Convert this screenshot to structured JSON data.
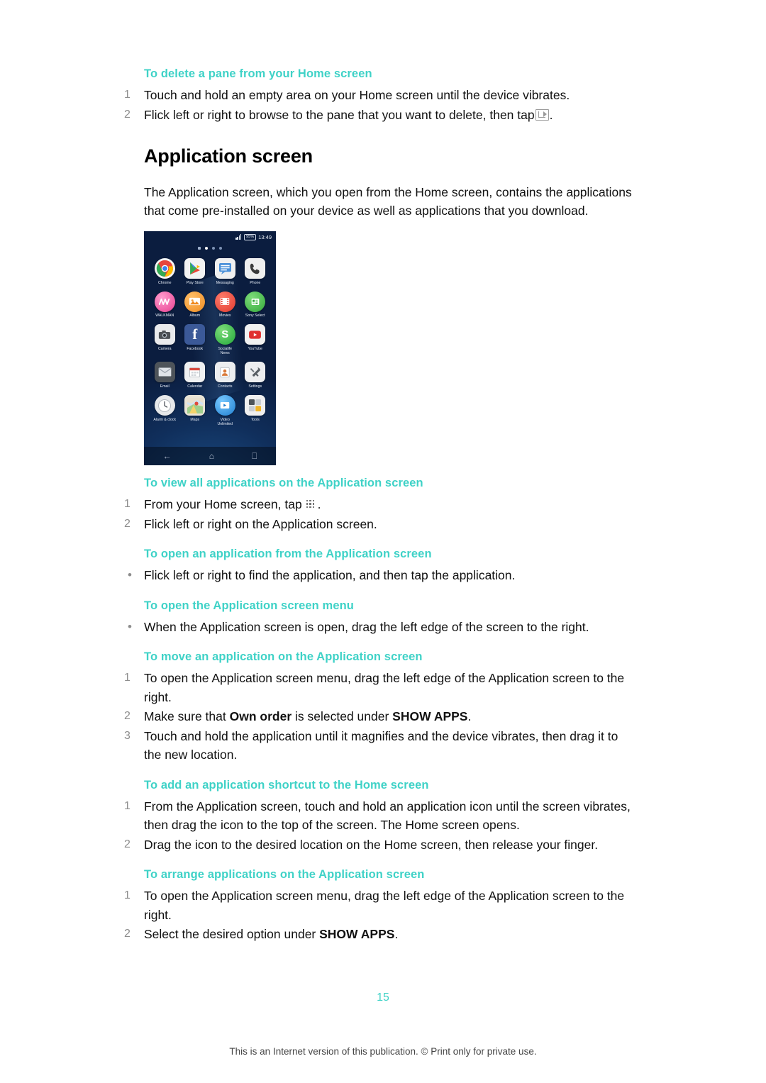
{
  "document": {
    "page_number": "15",
    "footer": "This is an Internet version of this publication. © Print only for private use."
  },
  "colors": {
    "heading_teal": "#3fd2c7",
    "body_text": "#111111",
    "step_number": "#8d8d8d"
  },
  "sections": [
    {
      "id": "delete-pane",
      "heading": "To delete a pane from your Home screen",
      "steps": [
        "Touch and hold an empty area on your Home screen until the device vibrates.",
        "Flick left or right to browse to the pane that you want to delete, then tap"
      ],
      "step2_suffix": "."
    }
  ],
  "application_screen": {
    "title": "Application screen",
    "intro": "The Application screen, which you open from the Home screen, contains the applications that come pre-installed on your device as well as applications that you download."
  },
  "phone": {
    "status": {
      "battery": "95%",
      "time": "13:49"
    },
    "apps": [
      {
        "label": "Chrome",
        "icon": "chrome-icon"
      },
      {
        "label": "Play Store",
        "icon": "play-store-icon"
      },
      {
        "label": "Messaging",
        "icon": "messaging-icon"
      },
      {
        "label": "Phone",
        "icon": "phone-icon"
      },
      {
        "label": "WALKMAN",
        "icon": "walkman-icon"
      },
      {
        "label": "Album",
        "icon": "album-icon"
      },
      {
        "label": "Movies",
        "icon": "movies-icon"
      },
      {
        "label": "Sony Select",
        "icon": "sony-select-icon"
      },
      {
        "label": "Camera",
        "icon": "camera-icon"
      },
      {
        "label": "Facebook",
        "icon": "facebook-icon"
      },
      {
        "label": "Socialife\nNews",
        "icon": "socialife-icon"
      },
      {
        "label": "YouTube",
        "icon": "youtube-icon"
      },
      {
        "label": "Email",
        "icon": "email-icon"
      },
      {
        "label": "Calendar",
        "icon": "calendar-icon"
      },
      {
        "label": "Contacts",
        "icon": "contacts-icon"
      },
      {
        "label": "Settings",
        "icon": "settings-icon"
      },
      {
        "label": "Alarm & clock",
        "icon": "alarm-clock-icon"
      },
      {
        "label": "Maps",
        "icon": "maps-icon"
      },
      {
        "label": "Video\nUnlimited",
        "icon": "video-unlimited-icon"
      },
      {
        "label": "Tools",
        "icon": "tools-icon"
      }
    ],
    "nav": {
      "back": "back-icon",
      "home": "home-icon",
      "recents": "recents-icon"
    }
  },
  "procedures": [
    {
      "id": "view-all-applications",
      "heading": "To view all applications on the Application screen",
      "type": "steps",
      "items": [
        "From your Home screen, tap",
        "Flick left or right on the Application screen."
      ],
      "item1_suffix": "."
    },
    {
      "id": "open-application",
      "heading": "To open an application from the Application screen",
      "type": "bullets",
      "items": [
        "Flick left or right to find the application, and then tap the application."
      ]
    },
    {
      "id": "open-application-screen-menu",
      "heading": "To open the Application screen menu",
      "type": "bullets",
      "items": [
        "When the Application screen is open, drag the left edge of the screen to the right."
      ]
    },
    {
      "id": "move-application",
      "heading": "To move an application on the Application screen",
      "type": "steps",
      "items": [
        "To open the Application screen menu, drag the left edge of the Application screen to the right.",
        "Make sure that Own order is selected under SHOW APPS.",
        "Touch and hold the application until it magnifies and the device vibrates, then drag it to the new location."
      ],
      "item2_parts": {
        "before": "Make sure that ",
        "bold1": "Own order",
        "middle": " is selected under ",
        "bold2": "SHOW APPS",
        "after": "."
      }
    },
    {
      "id": "add-application-shortcut",
      "heading": "To add an application shortcut to the Home screen",
      "type": "steps",
      "items": [
        "From the Application screen, touch and hold an application icon until the screen vibrates, then drag the icon to the top of the screen. The Home screen opens.",
        "Drag the icon to the desired location on the Home screen, then release your finger."
      ]
    },
    {
      "id": "arrange-applications",
      "heading": "To arrange applications on the Application screen",
      "type": "steps",
      "items": [
        "To open the Application screen menu, drag the left edge of the Application screen to the right.",
        "Select the desired option under SHOW APPS."
      ],
      "item2_parts": {
        "before": "Select the desired option under ",
        "bold1": "SHOW APPS",
        "after": "."
      }
    }
  ]
}
